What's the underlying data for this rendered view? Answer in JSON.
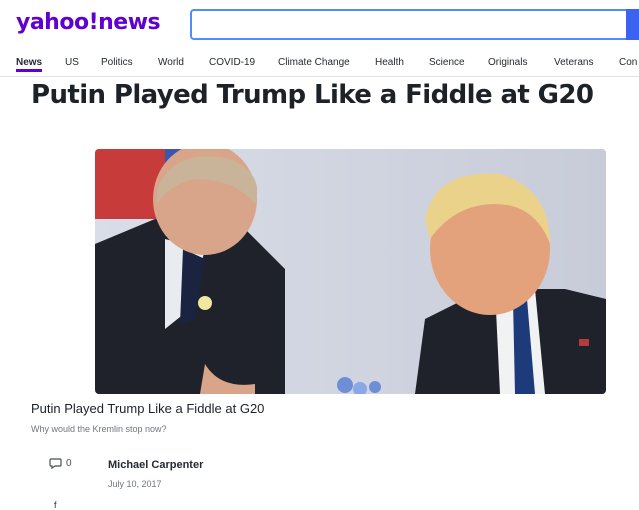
{
  "brand": {
    "yahoo": "yahoo",
    "bang": "!",
    "news": "news"
  },
  "search": {
    "placeholder": ""
  },
  "nav": {
    "items": [
      "News",
      "US",
      "Politics",
      "World",
      "COVID-19",
      "Climate Change",
      "Health",
      "Science",
      "Originals",
      "Veterans",
      "Con"
    ],
    "active": "News"
  },
  "article": {
    "headline": "Putin Played Trump Like a Fiddle at G20",
    "caption_title": "Putin Played Trump Like a Fiddle at G20",
    "caption_sub": "Why would the Kremlin stop now?",
    "comments": "0",
    "author": "Michael Carpenter",
    "date": "July 10, 2017",
    "cut_glyph": "f"
  },
  "colors": {
    "brand": "#6001d2",
    "search_border": "#4e8cff",
    "search_button": "#3b63f0"
  },
  "icons": {
    "comment": "comment-icon",
    "search": "search-icon"
  }
}
